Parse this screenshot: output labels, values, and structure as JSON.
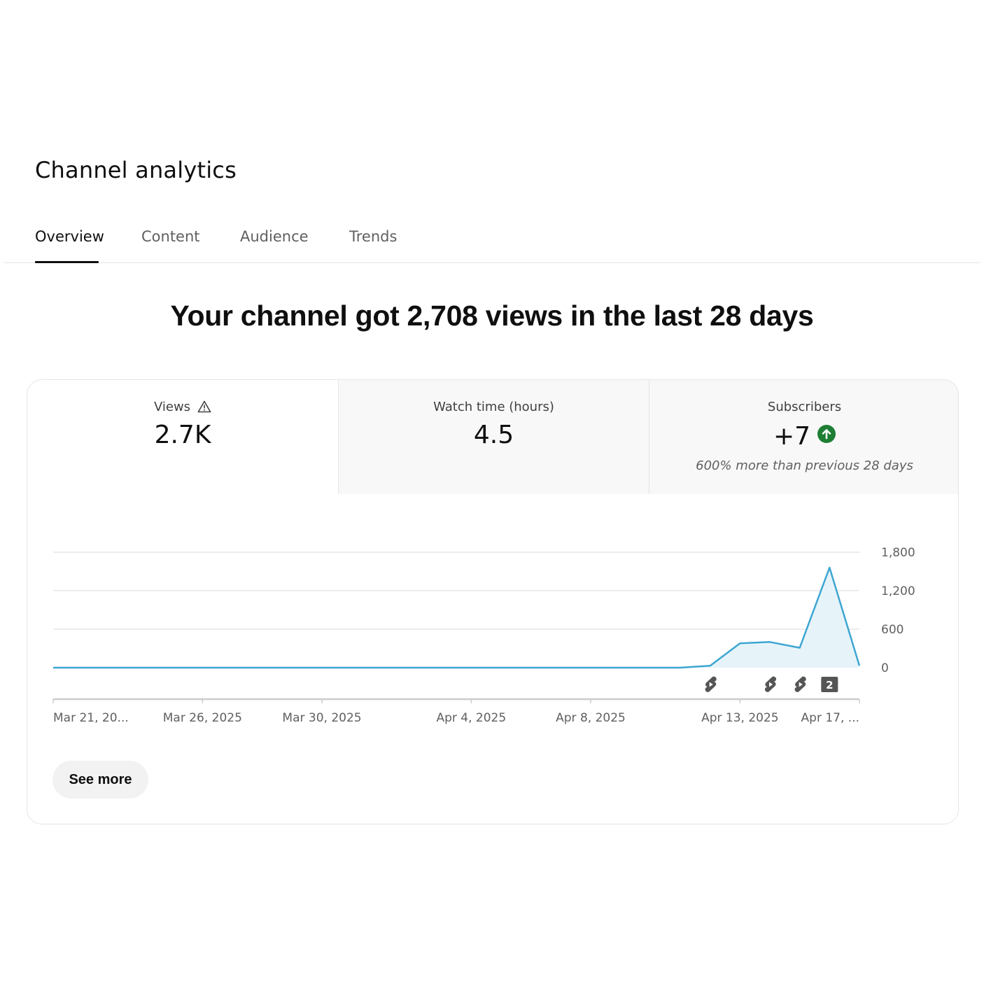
{
  "page": {
    "title": "Channel analytics"
  },
  "tabs": [
    {
      "label": "Overview",
      "active": true
    },
    {
      "label": "Content",
      "active": false
    },
    {
      "label": "Audience",
      "active": false
    },
    {
      "label": "Trends",
      "active": false
    }
  ],
  "headline": "Your channel got 2,708 views in the last 28 days",
  "metrics": [
    {
      "label": "Views",
      "value": "2.7K",
      "icon": "warning-icon",
      "selected": true
    },
    {
      "label": "Watch time (hours)",
      "value": "4.5",
      "selected": false
    },
    {
      "label": "Subscribers",
      "value": "+7",
      "icon": "arrow-up-circle-icon",
      "note": "600% more than previous 28 days",
      "selected": false
    }
  ],
  "colors": {
    "line": "#3ea6d1",
    "area": "#e6f4fa",
    "up_indicator": "#1e7e34",
    "marker": "#555555"
  },
  "chart_data": {
    "type": "area",
    "x": [
      "Mar 21, 2025",
      "Mar 22, 2025",
      "Mar 23, 2025",
      "Mar 24, 2025",
      "Mar 25, 2025",
      "Mar 26, 2025",
      "Mar 27, 2025",
      "Mar 28, 2025",
      "Mar 29, 2025",
      "Mar 30, 2025",
      "Mar 31, 2025",
      "Apr 1, 2025",
      "Apr 2, 2025",
      "Apr 3, 2025",
      "Apr 4, 2025",
      "Apr 5, 2025",
      "Apr 6, 2025",
      "Apr 7, 2025",
      "Apr 8, 2025",
      "Apr 9, 2025",
      "Apr 10, 2025",
      "Apr 11, 2025",
      "Apr 12, 2025",
      "Apr 13, 2025",
      "Apr 14, 2025",
      "Apr 15, 2025",
      "Apr 16, 2025",
      "Apr 17, 2025"
    ],
    "series": [
      {
        "values": [
          0,
          0,
          0,
          0,
          0,
          0,
          0,
          0,
          0,
          0,
          0,
          0,
          0,
          0,
          0,
          0,
          0,
          0,
          0,
          0,
          0,
          0,
          30,
          380,
          400,
          310,
          1560,
          30
        ]
      }
    ],
    "ylim": [
      0,
      1800
    ],
    "yticks": [
      "0",
      "600",
      "1,200",
      "1,800"
    ],
    "ytick_values": [
      0,
      600,
      1200,
      1800
    ],
    "xtick_labels": [
      "Mar 21, 20...",
      "Mar 26, 2025",
      "Mar 30, 2025",
      "Apr 4, 2025",
      "Apr 8, 2025",
      "Apr 13, 2025",
      "Apr 17, ..."
    ],
    "xtick_index": [
      0,
      5,
      9,
      14,
      18,
      23,
      27
    ],
    "markers": [
      {
        "index": 22,
        "icon": "shorts-icon"
      },
      {
        "index": 24,
        "icon": "shorts-icon"
      },
      {
        "index": 25,
        "icon": "shorts-icon"
      },
      {
        "index": 26,
        "icon": "count-badge-icon",
        "label": "2"
      }
    ],
    "grid": true
  },
  "actions": {
    "see_more": "See more"
  }
}
